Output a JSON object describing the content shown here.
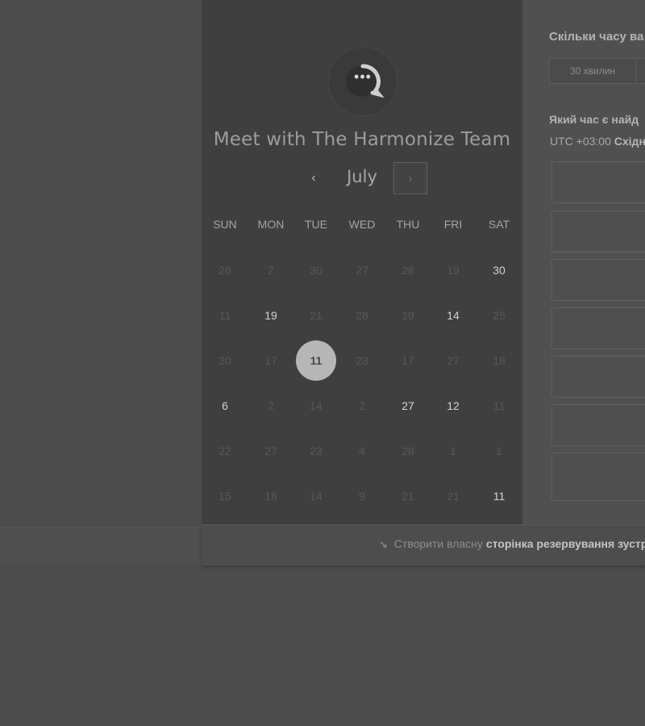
{
  "booking": {
    "team_name": "Meet with The Harmonize Team",
    "logo_icon": "chat-bubble-ellipsis-icon",
    "logo_dots": "•••",
    "month": "July",
    "prev_label": "‹",
    "next_label": "›",
    "weekdays": [
      "SUN",
      "MON",
      "TUE",
      "WED",
      "THU",
      "FRI",
      "SAT"
    ],
    "weeks": [
      [
        {
          "d": "26",
          "s": "muted"
        },
        {
          "d": "2",
          "s": "muted"
        },
        {
          "d": "30",
          "s": "muted"
        },
        {
          "d": "27",
          "s": "muted"
        },
        {
          "d": "28",
          "s": "muted"
        },
        {
          "d": "19",
          "s": "muted"
        },
        {
          "d": "30",
          "s": "avail"
        }
      ],
      [
        {
          "d": "11",
          "s": "muted"
        },
        {
          "d": "19",
          "s": "avail"
        },
        {
          "d": "21",
          "s": "muted"
        },
        {
          "d": "28",
          "s": "muted"
        },
        {
          "d": "19",
          "s": "muted"
        },
        {
          "d": "14",
          "s": "avail"
        },
        {
          "d": "25",
          "s": "muted"
        }
      ],
      [
        {
          "d": "30",
          "s": "muted"
        },
        {
          "d": "17",
          "s": "muted"
        },
        {
          "d": "11",
          "s": "selected"
        },
        {
          "d": "23",
          "s": "muted"
        },
        {
          "d": "17",
          "s": "muted"
        },
        {
          "d": "27",
          "s": "muted"
        },
        {
          "d": "18",
          "s": "muted"
        }
      ],
      [
        {
          "d": "6",
          "s": "avail"
        },
        {
          "d": "2",
          "s": "muted"
        },
        {
          "d": "14",
          "s": "muted"
        },
        {
          "d": "2",
          "s": "muted"
        },
        {
          "d": "27",
          "s": "avail"
        },
        {
          "d": "12",
          "s": "avail"
        },
        {
          "d": "11",
          "s": "muted"
        }
      ],
      [
        {
          "d": "22",
          "s": "muted"
        },
        {
          "d": "27",
          "s": "muted"
        },
        {
          "d": "23",
          "s": "muted"
        },
        {
          "d": "4",
          "s": "muted"
        },
        {
          "d": "28",
          "s": "muted"
        },
        {
          "d": "1",
          "s": "muted"
        },
        {
          "d": "1",
          "s": "muted"
        }
      ],
      [
        {
          "d": "15",
          "s": "muted"
        },
        {
          "d": "18",
          "s": "muted"
        },
        {
          "d": "14",
          "s": "muted"
        },
        {
          "d": "9",
          "s": "muted"
        },
        {
          "d": "21",
          "s": "muted"
        },
        {
          "d": "21",
          "s": "muted"
        },
        {
          "d": "11",
          "s": "avail"
        }
      ]
    ]
  },
  "details": {
    "duration_question": "Скільки часу ва",
    "duration_option": "30 хвилин",
    "time_question": "Який час є найд",
    "timezone_offset": "UTC +03:00",
    "timezone_name": "Східн"
  },
  "footer": {
    "prefix": "Створити власну",
    "link": "сторінка резервування зустр",
    "icon": "hubspot-sprocket-icon"
  },
  "colors": {
    "left_panel": "#3f3f3f",
    "right_panel": "#505050",
    "selected_day": "#b6b6b6"
  }
}
